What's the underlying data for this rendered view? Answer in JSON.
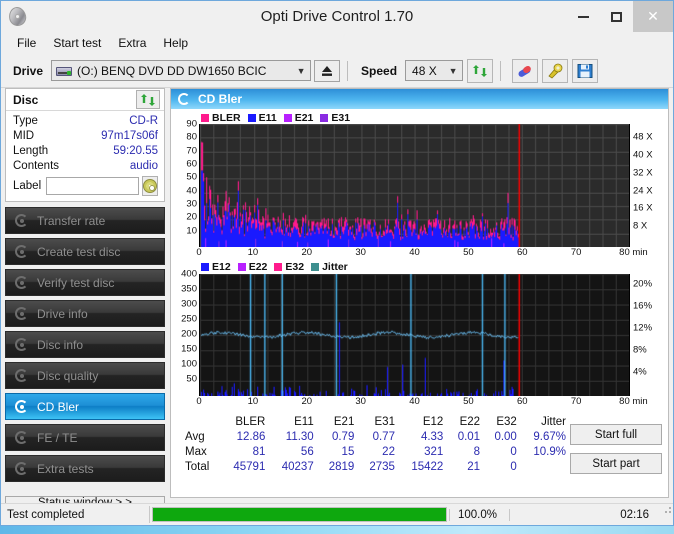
{
  "window": {
    "title": "Opti Drive Control 1.70",
    "app_icon": "disc-icon",
    "minimize": "minimize-icon",
    "maximize": "maximize-icon",
    "close": "close-icon"
  },
  "menu": {
    "items": [
      "File",
      "Start test",
      "Extra",
      "Help"
    ]
  },
  "toolbar": {
    "drive_label": "Drive",
    "drive_value": "(O:)   BENQ DVD DD DW1650 BCIC",
    "eject_icon": "eject-icon",
    "speed_label": "Speed",
    "speed_value": "48 X",
    "refresh_icon": "refresh-icon",
    "erase_icon": "erase-icon",
    "tools_icon": "tools-icon",
    "save_icon": "save-icon"
  },
  "disc_panel": {
    "title": "Disc",
    "refresh_icon": "refresh-icon",
    "rows": [
      {
        "key": "Type",
        "value": "CD-R"
      },
      {
        "key": "MID",
        "value": "97m17s06f"
      },
      {
        "key": "Length",
        "value": "59:20.55"
      },
      {
        "key": "Contents",
        "value": "audio"
      }
    ],
    "label_key": "Label",
    "label_value": "",
    "label_placeholder": "",
    "label_button_icon": "cd-icon"
  },
  "sidebar": {
    "items": [
      {
        "label": "Transfer rate",
        "active": false
      },
      {
        "label": "Create test disc",
        "active": false
      },
      {
        "label": "Verify test disc",
        "active": false
      },
      {
        "label": "Drive info",
        "active": false
      },
      {
        "label": "Disc info",
        "active": false
      },
      {
        "label": "Disc quality",
        "active": false
      },
      {
        "label": "CD Bler",
        "active": true
      },
      {
        "label": "FE / TE",
        "active": false
      },
      {
        "label": "Extra tests",
        "active": false
      }
    ],
    "status_window_label": "Status window > >"
  },
  "content": {
    "header_title": "CD Bler",
    "header_icon": "disc-scan-icon"
  },
  "actions": {
    "start_full": "Start full",
    "start_part": "Start part"
  },
  "statusbar": {
    "text": "Test completed",
    "percent_label": "100.0%",
    "percent_value": 100,
    "time": "02:16",
    "bar_color": "#0ea80e"
  },
  "stats": {
    "columns": [
      "",
      "BLER",
      "E11",
      "E21",
      "E31",
      "E12",
      "E22",
      "E32",
      "Jitter"
    ],
    "rows": [
      {
        "label": "Avg",
        "values": [
          "12.86",
          "11.30",
          "0.79",
          "0.77",
          "4.33",
          "0.01",
          "0.00",
          "9.67%"
        ]
      },
      {
        "label": "Max",
        "values": [
          "81",
          "56",
          "15",
          "22",
          "321",
          "8",
          "0",
          "10.9%"
        ]
      },
      {
        "label": "Total",
        "values": [
          "45791",
          "40237",
          "2819",
          "2735",
          "15422",
          "21",
          "0",
          ""
        ]
      }
    ]
  },
  "chart_data": [
    {
      "id": "bler-chart",
      "type": "area",
      "title": "CD Bler",
      "xlabel": "min",
      "ylabel": "",
      "xlim": [
        0,
        80
      ],
      "ylim": [
        0,
        90
      ],
      "xticks": [
        0,
        10,
        20,
        30,
        40,
        50,
        60,
        70,
        80
      ],
      "xtick_labels": [
        "0",
        "10",
        "20",
        "30",
        "40",
        "50",
        "60",
        "70",
        "80 min"
      ],
      "yticks": [
        10,
        20,
        30,
        40,
        50,
        60,
        70,
        80,
        90
      ],
      "right_axis_label": "X",
      "right_ylim": [
        0,
        54
      ],
      "right_yticks": [
        8,
        16,
        24,
        32,
        40,
        48
      ],
      "right_ytick_labels": [
        "8 X",
        "16 X",
        "24 X",
        "32 X",
        "40 X",
        "48 X"
      ],
      "grid": true,
      "data_end_min": 59.35,
      "marker_line_min": 59.35,
      "marker_line_color": "#ff0000",
      "legend_position": "top-left",
      "series": [
        {
          "name": "BLER",
          "color": "#ff1a8c",
          "avg": 12.86,
          "max": 81,
          "total": 45791
        },
        {
          "name": "E11",
          "color": "#1a1aff",
          "avg": 11.3,
          "max": 56,
          "total": 40237
        },
        {
          "name": "E21",
          "color": "#b820ff",
          "avg": 0.79,
          "max": 15,
          "total": 2819
        },
        {
          "name": "E31",
          "color": "#8a2be2",
          "avg": 0.77,
          "max": 22,
          "total": 2735
        }
      ]
    },
    {
      "id": "e12-jitter-chart",
      "type": "line",
      "title": "",
      "xlabel": "min",
      "ylabel": "",
      "xlim": [
        0,
        80
      ],
      "ylim": [
        0,
        400
      ],
      "xticks": [
        0,
        10,
        20,
        30,
        40,
        50,
        60,
        70,
        80
      ],
      "xtick_labels": [
        "0",
        "10",
        "20",
        "30",
        "40",
        "50",
        "60",
        "70",
        "80 min"
      ],
      "yticks": [
        50,
        100,
        150,
        200,
        250,
        300,
        350,
        400
      ],
      "right_axis_label": "%",
      "right_ylim": [
        0,
        22
      ],
      "right_yticks": [
        4,
        8,
        12,
        16,
        20
      ],
      "right_ytick_labels": [
        "4%",
        "8%",
        "12%",
        "16%",
        "20%"
      ],
      "grid": true,
      "data_end_min": 59.35,
      "marker_line_min": 59.35,
      "marker_line_color": "#ff0000",
      "legend_position": "top-left",
      "jitter_avg_pct": 9.67,
      "jitter_max_pct": 10.9,
      "series": [
        {
          "name": "E12",
          "color": "#1a1aff",
          "avg": 4.33,
          "max": 321,
          "total": 15422
        },
        {
          "name": "E22",
          "color": "#b820ff",
          "avg": 0.01,
          "max": 8,
          "total": 21
        },
        {
          "name": "E32",
          "color": "#ff1a8c",
          "avg": 0.0,
          "max": 0,
          "total": 0
        },
        {
          "name": "Jitter",
          "color": "#3e8f8f",
          "avg": 9.67,
          "max": 10.9,
          "total": null
        }
      ]
    }
  ]
}
